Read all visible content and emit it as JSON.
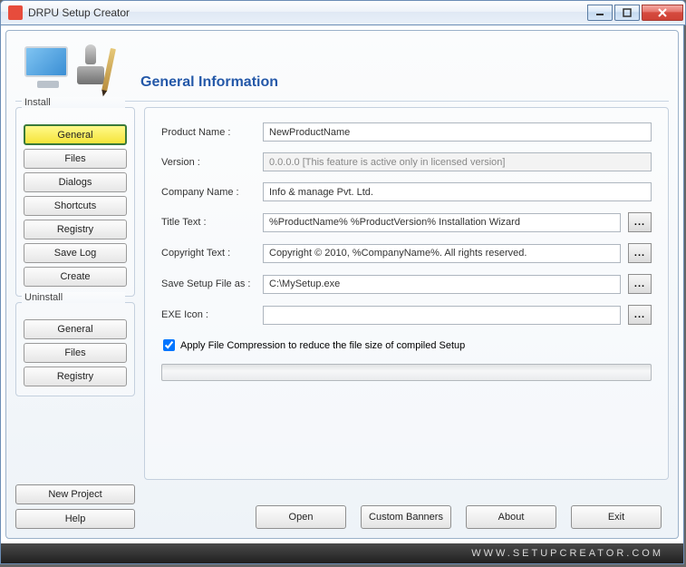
{
  "window": {
    "title": "DRPU Setup Creator"
  },
  "header": {
    "title": "General Information"
  },
  "sidebar": {
    "install_label": "Install",
    "uninstall_label": "Uninstall",
    "install": [
      "General",
      "Files",
      "Dialogs",
      "Shortcuts",
      "Registry",
      "Save Log",
      "Create"
    ],
    "uninstall": [
      "General",
      "Files",
      "Registry"
    ],
    "active_index": 0
  },
  "fields": {
    "product_name": {
      "label": "Product Name :",
      "value": "NewProductName"
    },
    "version": {
      "label": "Version :",
      "value": "0.0.0.0 [This feature is active only in licensed version]"
    },
    "company": {
      "label": "Company Name :",
      "value": "Info & manage Pvt. Ltd."
    },
    "title_text": {
      "label": "Title Text :",
      "value": "%ProductName% %ProductVersion% Installation Wizard"
    },
    "copyright": {
      "label": "Copyright Text :",
      "value": "Copyright © 2010, %CompanyName%. All rights reserved."
    },
    "save_as": {
      "label": "Save Setup File as :",
      "value": "C:\\MySetup.exe"
    },
    "exe_icon": {
      "label": "EXE Icon :",
      "value": ""
    },
    "browse": "..."
  },
  "compression": {
    "checked": true,
    "label": "Apply File Compression to reduce the file size of compiled Setup"
  },
  "bottom": {
    "new_project": "New Project",
    "help": "Help",
    "open": "Open",
    "custom_banners": "Custom Banners",
    "about": "About",
    "exit": "Exit"
  },
  "footer": {
    "url": "WWW.SETUPCREATOR.COM"
  }
}
